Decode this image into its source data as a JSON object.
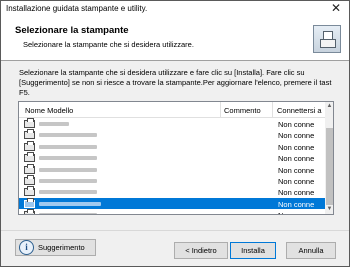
{
  "window": {
    "title": "Installazione guidata stampante e utility.",
    "close_glyph": "✕"
  },
  "header": {
    "title": "Selezionare la stampante",
    "subtitle": "Selezionare la stampante che si desidera utilizzare.",
    "icon": "printer-setup-icon"
  },
  "instructions": "Selezionare la stampante che si desidera utilizzare e fare clic su [Installa]. Fare clic su [Suggerimento] se non si riesce a trovare la stampante.Per aggiornare l'elenco, premere il tast F5.",
  "list": {
    "columns": [
      "Nome Modello",
      "Commento",
      "Connettersi a"
    ],
    "rows": [
      {
        "status": "Non conne",
        "selected": false,
        "icon": "printer-icon"
      },
      {
        "status": "Non conne",
        "selected": false,
        "icon": "printer-icon"
      },
      {
        "status": "Non conne",
        "selected": false,
        "icon": "printer-icon"
      },
      {
        "status": "Non conne",
        "selected": false,
        "icon": "printer-icon"
      },
      {
        "status": "Non conne",
        "selected": false,
        "icon": "printer-icon"
      },
      {
        "status": "Non conne",
        "selected": false,
        "icon": "printer-icon"
      },
      {
        "status": "Non conne",
        "selected": false,
        "icon": "printer-icon"
      },
      {
        "status": "Non conne",
        "selected": true,
        "icon": "printer-icon"
      },
      {
        "status": "Non conne",
        "selected": false,
        "icon": "printer-icon"
      }
    ],
    "selection_color": "#0078d7",
    "scroll_up_glyph": "▲",
    "scroll_down_glyph": "▼"
  },
  "buttons": {
    "suggestion_label": "Suggerimento",
    "suggestion_icon_glyph": "i",
    "back_label": "< Indietro",
    "install_label": "Installa",
    "cancel_label": "Annulla"
  }
}
